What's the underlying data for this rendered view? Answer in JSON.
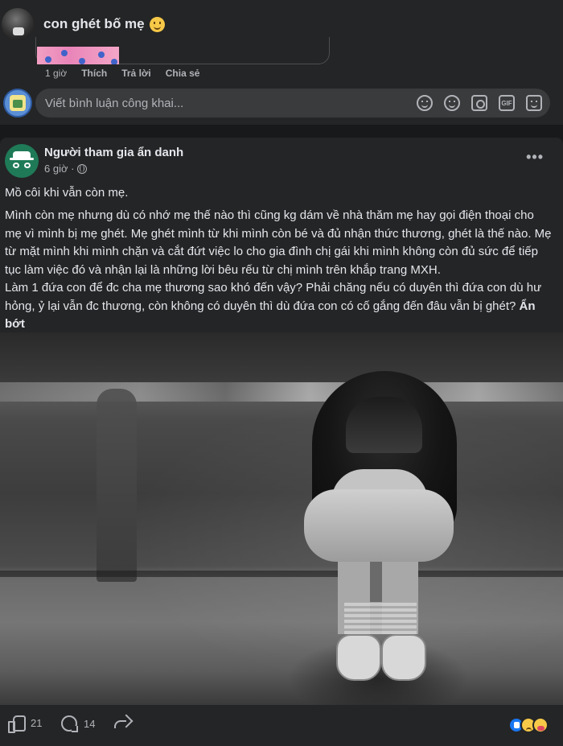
{
  "comment": {
    "text": "con ghét bố mẹ",
    "emoji_icon": "smile-emoji",
    "actions": {
      "time": "1 giờ",
      "like": "Thích",
      "reply": "Trả lời",
      "share": "Chia sẻ"
    }
  },
  "reply_box": {
    "placeholder": "Viết bình luận công khai...",
    "icons": [
      "avatar-icon",
      "emoji-picker-icon",
      "camera-icon",
      "gif-icon",
      "sticker-icon"
    ]
  },
  "post": {
    "author": "Người tham gia ẩn danh",
    "time": "6 giờ ·",
    "privacy_icon": "globe-icon",
    "title": "Mồ côi khi vẫn còn mẹ.",
    "body": "Mình còn mẹ nhưng dù có nhớ mẹ thế nào thì cũng kg dám về nhà thăm mẹ hay gọi điện thoại cho mẹ vì mình bị mẹ ghét. Mẹ ghét mình từ khi mình còn bé và đủ nhận thức thương, ghét là thế nào. Mẹ từ mặt mình khi mình chặn và cắt đứt việc lo cho gia đình chị gái khi mình không còn đủ sức để tiếp tục làm việc đó và nhận lại là những lời bêu rếu từ chị mình trên khắp trang MXH.",
    "body2": "Làm 1 đứa con để đc cha mẹ thương sao khó đến vậy? Phải chăng nếu có duyên thì đứa con dù hư hỏng, ỷ lại vẫn đc thương, còn không có duyên thì dù đứa con có cố gắng đến đâu vẫn bị ghét?",
    "see_less": "Ẩn bớt",
    "image_icon": "girl-hugging-knees-photo"
  },
  "footer": {
    "likes": "21",
    "comments": "14",
    "reaction_icons": [
      "like-reaction",
      "sad-reaction",
      "care-reaction"
    ]
  },
  "colors": {
    "background": "#18191a",
    "card": "#242526",
    "input": "#3a3b3c",
    "text_primary": "#e4e6eb",
    "text_secondary": "#b0b3b8",
    "accent": "#1877f2"
  }
}
